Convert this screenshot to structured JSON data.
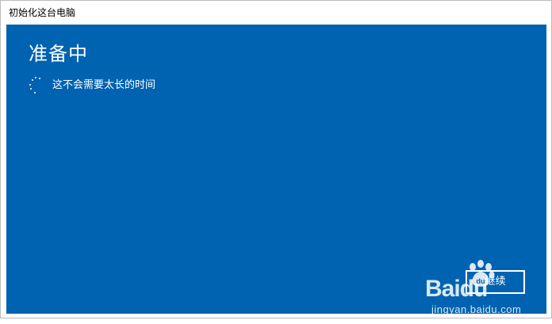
{
  "window": {
    "title": "初始化这台电脑"
  },
  "main": {
    "heading": "准备中",
    "status_text": "这不会需要太长的时间",
    "spinner_icon": "loading-spinner-icon"
  },
  "footer": {
    "continue_label": "继续"
  },
  "watermark": {
    "brand": "Baidu",
    "url": "jingyan.baidu.com"
  },
  "colors": {
    "accent_background": "#0063b1",
    "text": "#ffffff",
    "titlebar": "#ffffff"
  }
}
